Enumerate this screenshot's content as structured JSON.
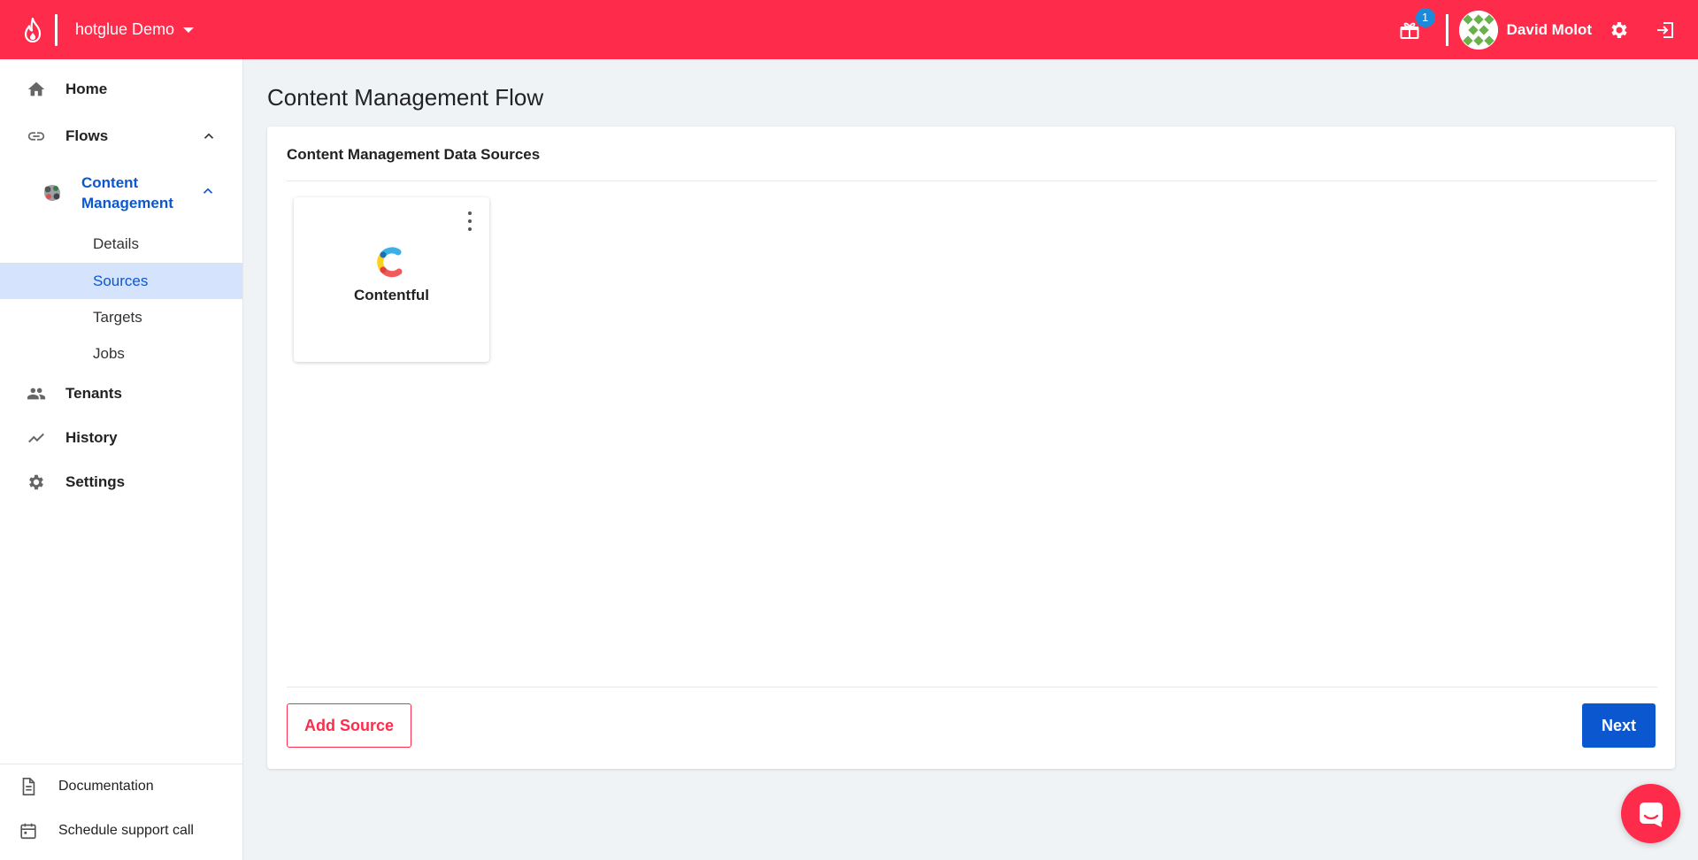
{
  "topbar": {
    "workspace": "hotglue Demo",
    "notification_count": "1",
    "username": "David Molot"
  },
  "sidebar": {
    "home": "Home",
    "flows": "Flows",
    "flow_group": "Content Management",
    "flow_sub": [
      "Details",
      "Sources",
      "Targets",
      "Jobs"
    ],
    "active_sub": "Sources",
    "tenants": "Tenants",
    "history": "History",
    "settings": "Settings",
    "documentation": "Documentation",
    "support": "Schedule support call"
  },
  "main": {
    "title": "Content Management Flow",
    "card_title": "Content Management Data Sources",
    "sources": [
      {
        "name": "Contentful",
        "icon": "contentful-logo"
      }
    ],
    "add_button": "Add Source",
    "next_button": "Next"
  },
  "colors": {
    "brand": "#ff2b4a",
    "primary": "#0b57d0",
    "active_bg": "#d5e3fc",
    "badge": "#1c8ad8"
  },
  "icons": {
    "logo": "flame-icon",
    "gift": "gift-icon",
    "settings": "gear-icon",
    "logout": "logout-icon",
    "chat": "chat-icon"
  }
}
